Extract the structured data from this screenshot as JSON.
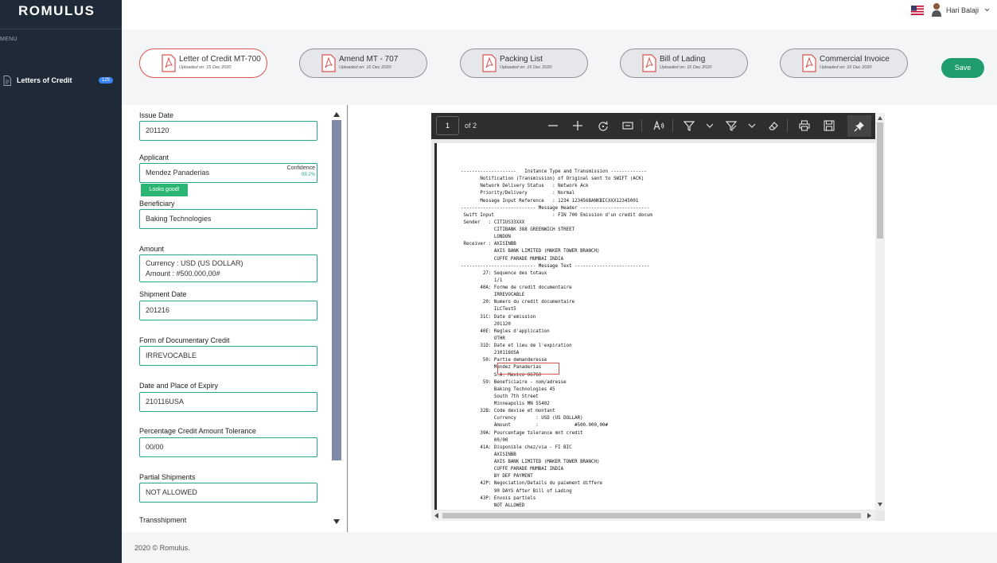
{
  "app": {
    "brand": "ROMULUS"
  },
  "sidebar": {
    "menu_label": "MENU",
    "items": [
      {
        "label": "Letters of Credit",
        "badge": "125",
        "icon": "document-icon"
      }
    ]
  },
  "header": {
    "user_name": "Hari Balaji",
    "flag": "us-flag-icon"
  },
  "documents": [
    {
      "title": "Letter of Credit MT-700",
      "uploaded": "Uploaded on: 15 Dec 2020",
      "active": true
    },
    {
      "title": "Amend MT - 707",
      "uploaded": "Uploaded on: 16 Dec 2020",
      "active": false
    },
    {
      "title": "Packing List",
      "uploaded": "Uploaded on: 16 Dec 2020",
      "active": false
    },
    {
      "title": "Bill of Lading",
      "uploaded": "Uploaded on: 16 Dec 2020",
      "active": false
    },
    {
      "title": "Commercial Invoice",
      "uploaded": "Uploaded on: 16 Dec 2020",
      "active": false
    }
  ],
  "save_label": "Save",
  "form": {
    "issue_date": {
      "label": "Issue Date",
      "value": "201120"
    },
    "applicant": {
      "label": "Applicant",
      "value": "Mendez Panaderias",
      "confidence_label": "Confidence",
      "confidence_value": "99.2%",
      "status": "Looks good!"
    },
    "beneficiary": {
      "label": "Beneficiary",
      "value": "Baking Technologies"
    },
    "amount": {
      "label": "Amount",
      "currency_line": "Currency : USD (US DOLLAR)",
      "amount_line": "Amount : #500.000,00#"
    },
    "shipment_date": {
      "label": "Shipment Date",
      "value": "201216"
    },
    "form_of_credit": {
      "label": "Form of Documentary Credit",
      "value": "IRREVOCABLE"
    },
    "expiry": {
      "label": "Date and Place of Expiry",
      "value": "210116USA"
    },
    "tolerance": {
      "label": "Percentage Credit Amount Tolerance",
      "value": "00/00"
    },
    "partial_shipments": {
      "label": "Partial Shipments",
      "value": "NOT ALLOWED"
    },
    "transshipment": {
      "label": "Transshipment"
    }
  },
  "viewer": {
    "page": "1",
    "page_of": "of 2",
    "document_text": "--------------------   Instance Type and Transmission -------------\n       Notification (Transmission) of Original sent to SWIFT (ACK)\n       Network Delivery Status   : Network Ack\n       Priority/Delivery         : Normal\n       Message Input Reference   : 1234 123456BANKBICXXX12345001\n--------------------------- Message Header -------------------------\n Swift Input                     : FIN 700 Emission d'un credit docum\n Sender   : CITIUS33XXX\n            CITIBANK 388 GREENWICH STREET\n            LONDON\n Receiver : AXISINBB\n            AXIS BANK LIMITED (MAKER TOWER BRANCH)\n            CUFFE PARADE MUMBAI INDIA\n--------------------------- Message Text ---------------------------\n        27: Sequence des totaux\n            1/1\n       40A: Forme de credit documentaire\n            IRREVOCABLE\n        20: Numero du credit documentaire\n            ILCTest5\n       31C: Date d'emission\n            201120\n       40E: Regles d'application\n            OTHR\n       31D: Date et lieu de l'expiration\n            210116USA\n        50: Partie demanderesse\n            Mendez Panaderias\n            S.A. Mexico 06760\n        59: Beneficiaire - nom/adresse\n            Baking Technologies 45\n            South 7th Street\n            Minneapolis MN 55402\n       32B: Code devise et montant\n            Currency       : USD (US DOLLAR)\n            Amount         :             #500.000,00#\n       39A: Pourcentage tolerance mnt credit\n            00/00\n       41A: Disponible chez/via - FI BIC\n            AXISINBB\n            AXIS BANK LIMITED (MAKER TOWER BRANCH)\n            CUFFE PARADE MUMBAI INDIA\n            BY DEF PAYMENT\n       42P: Negociation/Details du paiement differe\n            90 DAYS After Bill of Lading\n       43P: Envois partiels\n            NOT ALLOWED"
  },
  "footer": {
    "text": "2020 © Romulus."
  }
}
